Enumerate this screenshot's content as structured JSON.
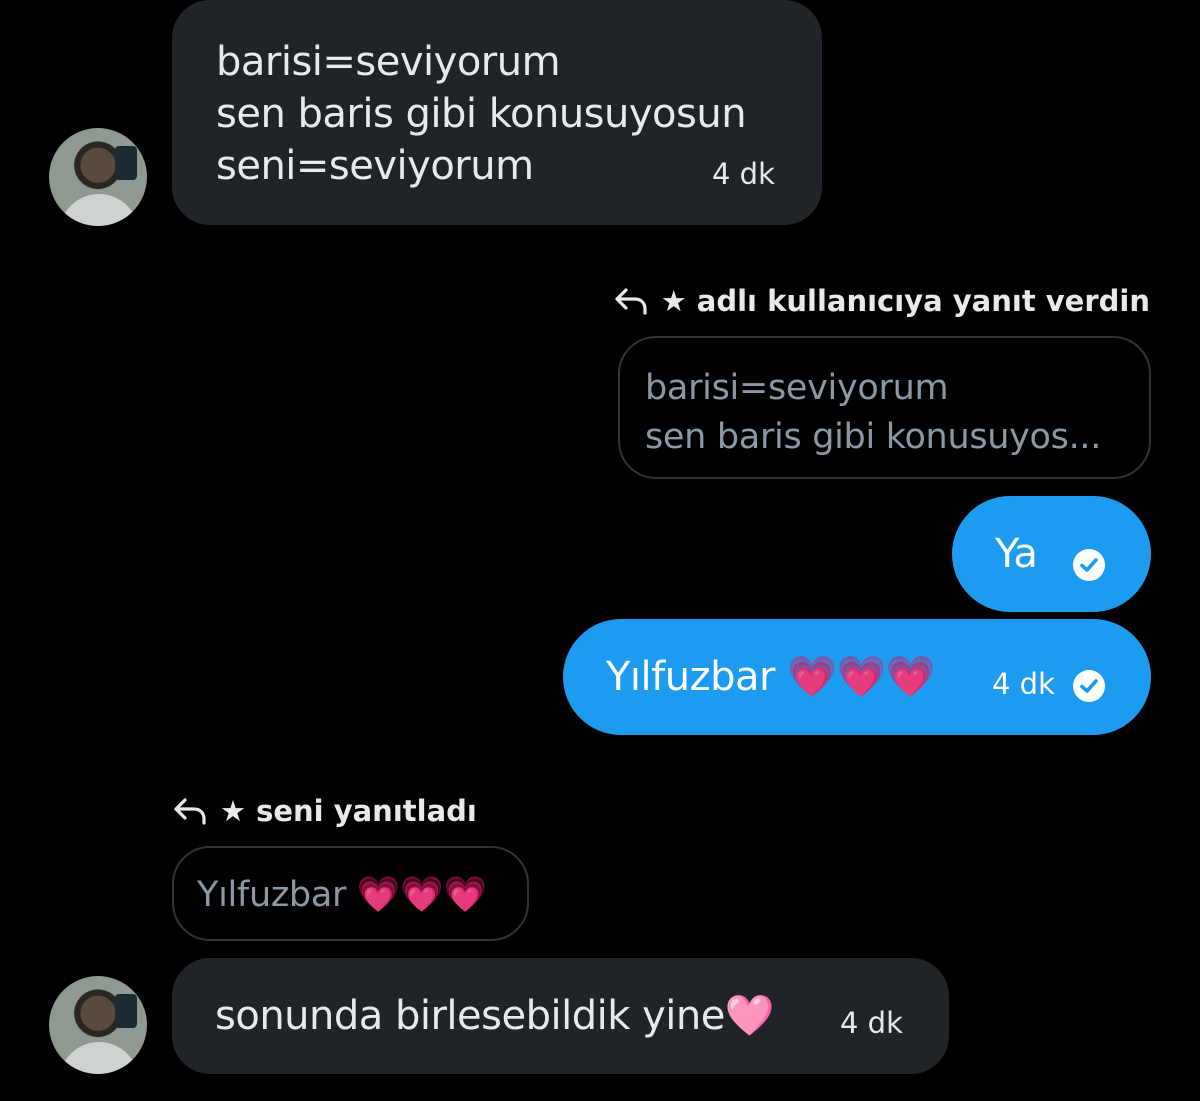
{
  "messages": {
    "m1": {
      "lines": [
        "barisi=seviyorum",
        "sen baris gibi konusuyosun",
        "seni=seviyorum"
      ],
      "time": "4 dk"
    },
    "r1": {
      "reply_info": "★ adlı kullanıcıya yanıt verdin",
      "quote_lines": [
        "barisi=seviyorum",
        "sen baris gibi konusuyos..."
      ]
    },
    "m2": {
      "text": "Ya",
      "status_icon": "check-circle-icon"
    },
    "m3": {
      "text": "Yılfuzbar 💗💗💗",
      "time": "4 dk",
      "status_icon": "check-circle-icon"
    },
    "r2": {
      "reply_info": "★ seni yanıtladı",
      "quote_text": "Yılfuzbar 💗💗💗"
    },
    "m4": {
      "text": "sonunda birlesebildik yine🩷",
      "time": "4 dk"
    }
  },
  "colors": {
    "background": "#000000",
    "incoming_bubble": "#202327",
    "outgoing_bubble": "#1d9bf0",
    "quote_border": "#2f3336",
    "quote_text": "#8b98a5"
  },
  "icons": {
    "reply": "reply-arrow-icon",
    "avatar": "user-avatar"
  }
}
